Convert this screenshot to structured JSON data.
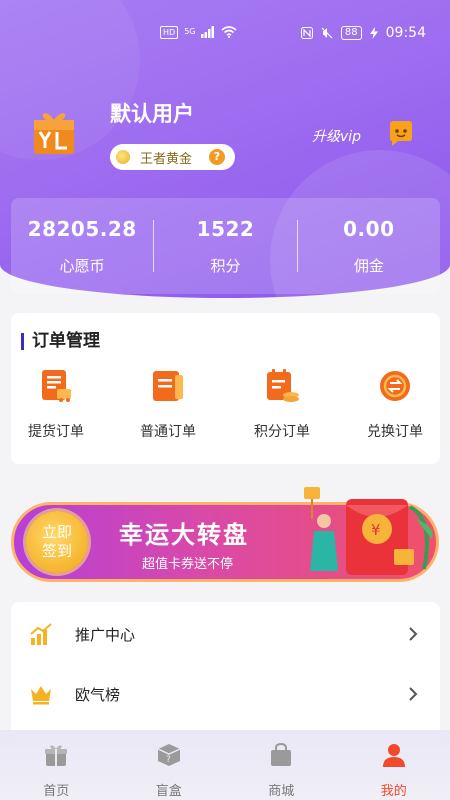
{
  "status_bar": {
    "hd": "HD",
    "network": "5G",
    "battery": "88",
    "time": "09:54"
  },
  "profile": {
    "username": "默认用户",
    "level": "王者黄金",
    "level_help_icon": "?",
    "vip_label": "升级vip"
  },
  "stats": [
    {
      "value": "28205.28",
      "label": "心愿币"
    },
    {
      "value": "1522",
      "label": "积分"
    },
    {
      "value": "0.00",
      "label": "佣金"
    }
  ],
  "orders": {
    "title": "订单管理",
    "items": [
      {
        "label": "提货订单",
        "icon": "pickup-order-icon"
      },
      {
        "label": "普通订单",
        "icon": "normal-order-icon"
      },
      {
        "label": "积分订单",
        "icon": "points-order-icon"
      },
      {
        "label": "兑换订单",
        "icon": "exchange-order-icon"
      }
    ]
  },
  "banner": {
    "sign_line1": "立即",
    "sign_line2": "签到",
    "title": "幸运大转盘",
    "subtitle": "超值卡券送不停"
  },
  "menu": [
    {
      "label": "推广中心",
      "icon": "bar-chart-icon"
    },
    {
      "label": "欧气榜",
      "icon": "crown-icon"
    }
  ],
  "tabs": [
    {
      "label": "首页",
      "icon": "gift-home-icon",
      "active": false
    },
    {
      "label": "盲盒",
      "icon": "mystery-box-icon",
      "active": false
    },
    {
      "label": "商城",
      "icon": "shopping-bag-icon",
      "active": false
    },
    {
      "label": "我的",
      "icon": "user-icon",
      "active": true
    }
  ],
  "colors": {
    "header_purple": "#9d6cf0",
    "accent_red": "#f04a2a",
    "order_orange": "#f26a1b",
    "title_bar_blue": "#3a2fb8"
  }
}
